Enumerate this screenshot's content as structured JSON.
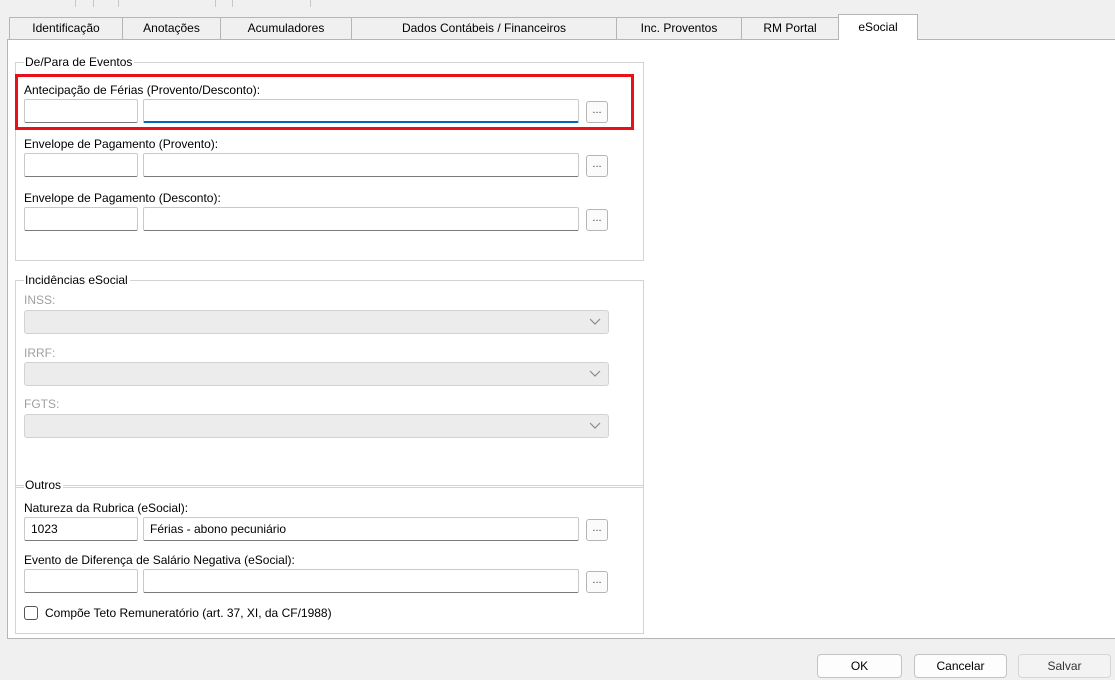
{
  "tabs": [
    {
      "label": "Identificação"
    },
    {
      "label": "Anotações"
    },
    {
      "label": "Acumuladores"
    },
    {
      "label": "Dados Contábeis / Financeiros"
    },
    {
      "label": "Inc. Proventos"
    },
    {
      "label": "RM Portal"
    },
    {
      "label": "eSocial",
      "active": true
    }
  ],
  "de_para": {
    "legend": "De/Para de Eventos",
    "antecipacao": {
      "label": "Antecipação de Férias (Provento/Desconto):",
      "code": "",
      "description": "",
      "button": "..."
    },
    "envelope_provento": {
      "label": "Envelope de Pagamento (Provento):",
      "code": "",
      "description": "",
      "button": "..."
    },
    "envelope_desconto": {
      "label": "Envelope de Pagamento (Desconto):",
      "code": "",
      "description": "",
      "button": "..."
    }
  },
  "incidencias": {
    "legend": "Incidências eSocial",
    "inss": {
      "label": "INSS:",
      "value": ""
    },
    "irrf": {
      "label": "IRRF:",
      "value": ""
    },
    "fgts": {
      "label": "FGTS:",
      "value": ""
    }
  },
  "outros": {
    "legend": "Outros",
    "natureza": {
      "label": "Natureza da Rubrica (eSocial):",
      "code": "1023",
      "description": "Férias - abono pecuniário",
      "button": "..."
    },
    "diferenca": {
      "label": "Evento de Diferença de Salário Negativa (eSocial):",
      "code": "",
      "description": "",
      "button": "..."
    },
    "teto": {
      "label": "Compõe Teto Remuneratório (art. 37, XI, da CF/1988)",
      "checked": false
    }
  },
  "buttons": {
    "ok": "OK",
    "cancel": "Cancelar",
    "save": "Salvar"
  },
  "colors": {
    "highlight": "#e8111a",
    "focus": "#0067c0"
  }
}
